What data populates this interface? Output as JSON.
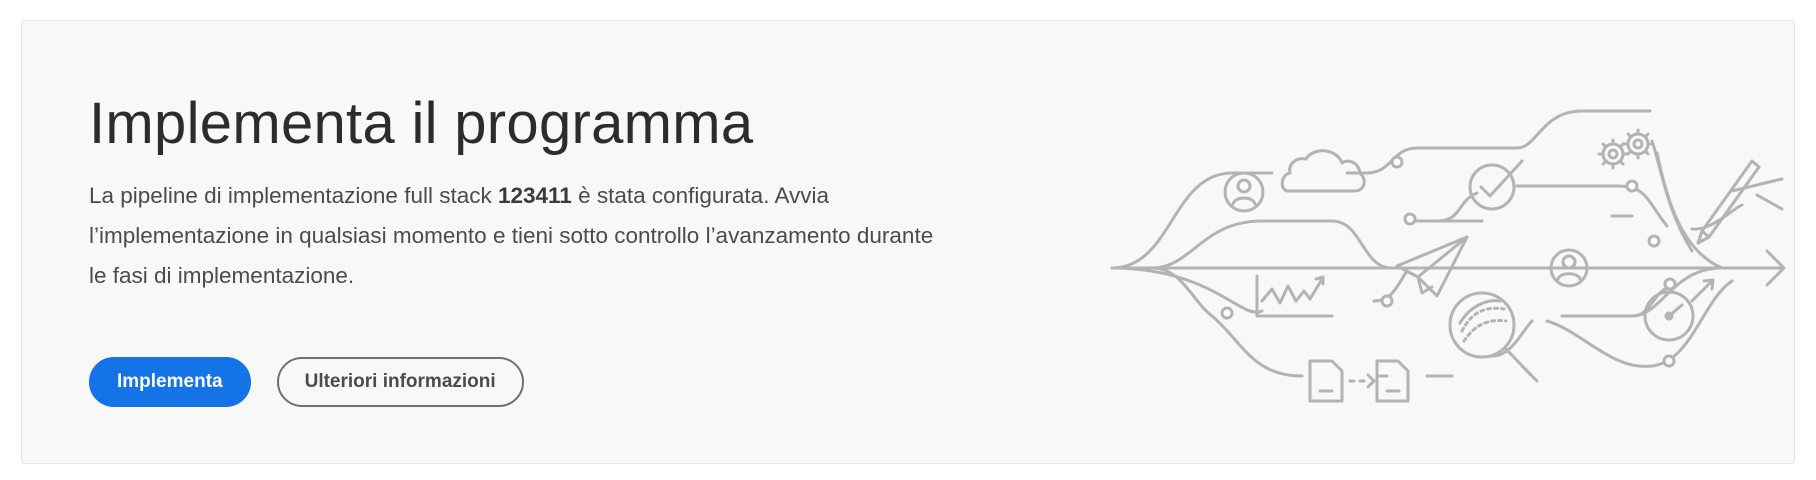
{
  "card": {
    "title": "Implementa il programma",
    "description_prefix": "La pipeline di implementazione full stack ",
    "pipeline_id": "123411",
    "description_suffix": " è stata configurata. Avvia l’implementazione in qualsiasi momento e tieni sotto controllo l’avanzamento durante le fasi di implementazione.",
    "primary_button_label": "Implementa",
    "secondary_button_label": "Ulteriori informazioni"
  },
  "illustration": {
    "icons": [
      "user-icon",
      "cloud-icon",
      "checkmark-icon",
      "gears-icon",
      "pen-icon",
      "chart-icon",
      "paper-plane-icon",
      "analytics-magnifier-icon",
      "gauge-icon",
      "document-icon"
    ]
  },
  "colors": {
    "primary": "#1473e6",
    "illustration_stroke": "#b3b3b3"
  }
}
